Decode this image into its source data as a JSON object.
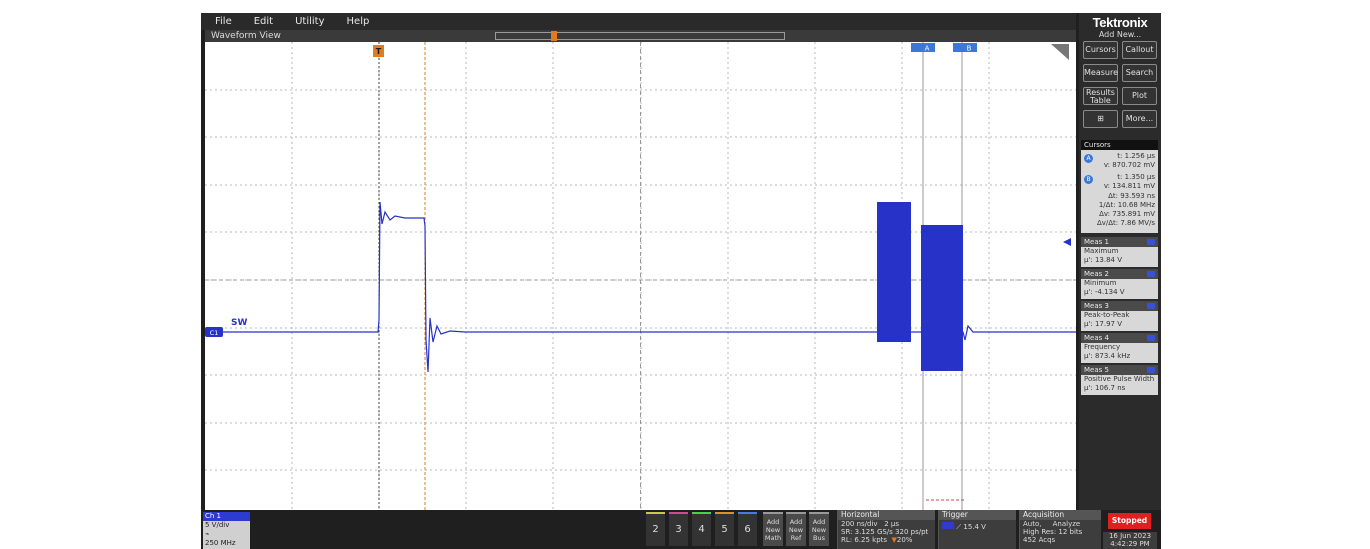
{
  "menu": [
    "File",
    "Edit",
    "Utility",
    "Help"
  ],
  "waveform_view": {
    "title": "Waveform View"
  },
  "trigger_marker": "T",
  "cursor_flags": {
    "a": "A",
    "b": "B"
  },
  "channel_marker": "C1",
  "channel_label": "SW",
  "brand": "Tektronix",
  "add_new": "Add New...",
  "panel_buttons": {
    "cursors": "Cursors",
    "callout": "Callout",
    "measure": "Measure",
    "search": "Search",
    "results_table": [
      "Results",
      "Table"
    ],
    "plot": "Plot",
    "more": "More..."
  },
  "cursors": {
    "title": "Cursors",
    "a": {
      "t": "t: 1.256 µs",
      "v": "v: 870.702 mV"
    },
    "b": {
      "t": "t: 1.350 µs",
      "v": "v: 134.811 mV"
    },
    "delta_t": "Δt: 93.593 ns",
    "inv_delta_t": "1/Δt: 10.68 MHz",
    "delta_v": "Δv: 735.891 mV",
    "dv_dt": "Δv/Δt: 7.86 MV/s"
  },
  "measurements": [
    {
      "label": "Meas 1",
      "name": "Maximum",
      "value": "µ': 13.84 V"
    },
    {
      "label": "Meas 2",
      "name": "Minimum",
      "value": "µ': -4.134 V"
    },
    {
      "label": "Meas 3",
      "name": "Peak-to-Peak",
      "value": "µ': 17.97 V"
    },
    {
      "label": "Meas 4",
      "name": "Frequency",
      "value": "µ': 873.4 kHz"
    },
    {
      "label": "Meas 5",
      "name": "Positive Pulse Width",
      "value": "µ': 106.7 ns"
    }
  ],
  "channel1": {
    "title": "Ch 1",
    "scale": "5 V/div",
    "bandwidth": "250 MHz"
  },
  "channel_buttons": [
    "2",
    "3",
    "4",
    "5",
    "6"
  ],
  "add_buttons": [
    [
      "Add",
      "New",
      "Math"
    ],
    [
      "Add",
      "New",
      "Ref"
    ],
    [
      "Add",
      "New",
      "Bus"
    ]
  ],
  "horizontal": {
    "title": "Horizontal",
    "scale": "200 ns/div",
    "span": "2 µs",
    "sr": "SR: 3.125 GS/s",
    "pts": "320 ps/pt",
    "rl": "RL: 6.25 kpts",
    "pos": "20%"
  },
  "trigger": {
    "title": "Trigger",
    "level": "15.4 V"
  },
  "acquisition": {
    "title": "Acquisition",
    "mode": "Auto,",
    "analyze": "Analyze",
    "res": "High Res: 12 bits",
    "count": "452 Acqs"
  },
  "status": "Stopped",
  "date": "16 Jun 2023",
  "time": "4:42:29 PM",
  "colors": {
    "waveform": "#2632c8",
    "trigger": "#e07b20",
    "cursor": "#3b78d8",
    "stopped": "#e02020"
  }
}
